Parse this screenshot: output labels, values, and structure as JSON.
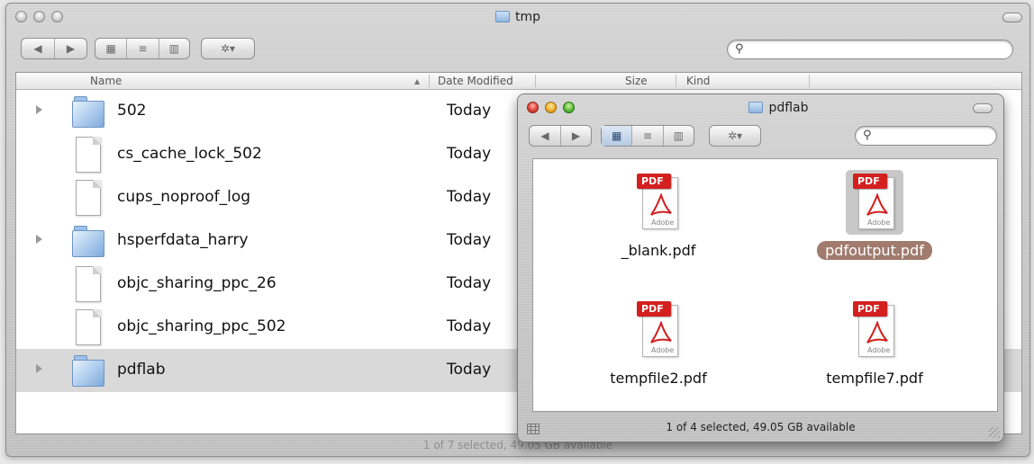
{
  "main_window": {
    "title": "tmp",
    "columns": {
      "name": "Name",
      "sort_indicator": "▲",
      "date_modified": "Date Modified",
      "size": "Size",
      "kind": "Kind"
    },
    "files": [
      {
        "name": "502",
        "date": "Today",
        "type": "folder",
        "expandable": true
      },
      {
        "name": "cs_cache_lock_502",
        "date": "Today",
        "type": "file",
        "expandable": false
      },
      {
        "name": "cups_noproof_log",
        "date": "Today",
        "type": "file",
        "expandable": false
      },
      {
        "name": "hsperfdata_harry",
        "date": "Today",
        "type": "folder",
        "expandable": true
      },
      {
        "name": "objc_sharing_ppc_26",
        "date": "Today",
        "type": "file",
        "expandable": false
      },
      {
        "name": "objc_sharing_ppc_502",
        "date": "Today",
        "type": "file",
        "expandable": false
      },
      {
        "name": "pdflab",
        "date": "Today",
        "type": "folder",
        "expandable": true,
        "selected": true
      }
    ],
    "status": "1 of 7 selected, 49.05 GB available",
    "search_icon": "magnifier-icon",
    "search_glyph": "⚲"
  },
  "pdf_window": {
    "title": "pdflab",
    "items": [
      {
        "name": "_blank.pdf",
        "tag": "PDF",
        "brand": "Adobe",
        "selected": false
      },
      {
        "name": "pdfoutput.pdf",
        "tag": "PDF",
        "brand": "Adobe",
        "selected": true
      },
      {
        "name": "tempfile2.pdf",
        "tag": "PDF",
        "brand": "Adobe",
        "selected": false
      },
      {
        "name": "tempfile7.pdf",
        "tag": "PDF",
        "brand": "Adobe",
        "selected": false
      }
    ],
    "status": "1 of 4 selected, 49.05 GB available"
  },
  "toolbar": {
    "back_glyph": "◀",
    "forward_glyph": "▶",
    "icon_view_glyph": "▦",
    "list_view_glyph": "≡",
    "column_view_glyph": "▥",
    "action_glyph": "✲▾",
    "search_glyph": "⚲"
  },
  "colors": {
    "selection_row": "#d9d9d9",
    "label_highlight": "#a07b6e",
    "pdf_red": "#d3201f"
  }
}
